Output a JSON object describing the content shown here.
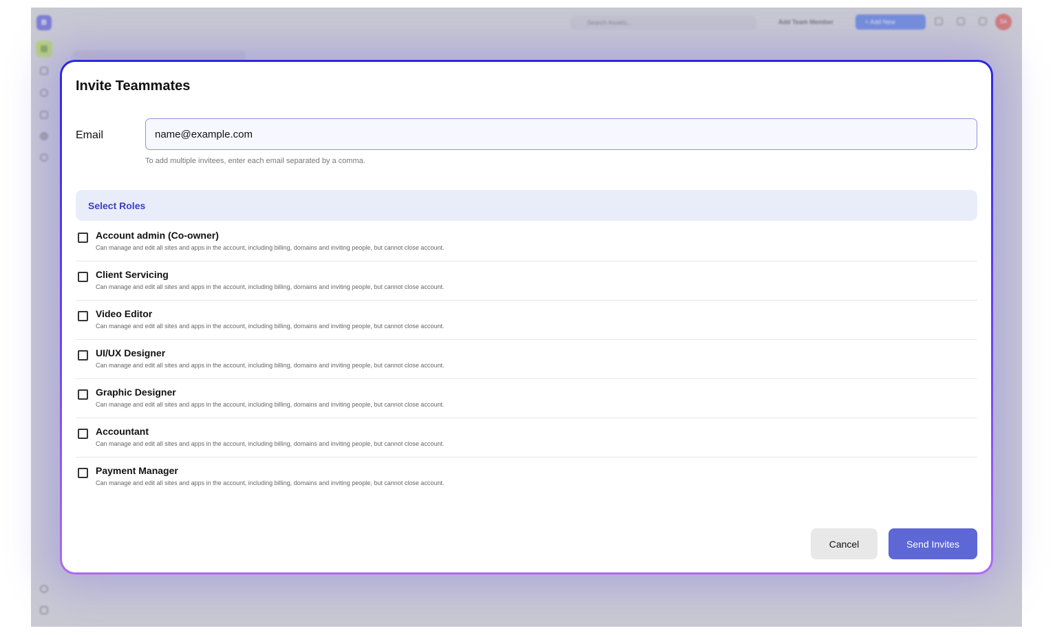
{
  "background": {
    "logo_letter": "B",
    "search_placeholder": "Search Assets...",
    "add_team_member_label": "Add Team Member",
    "add_new_label": "+ Add New",
    "avatar_initials": "SA"
  },
  "modal": {
    "title": "Invite Teammates",
    "email_label": "Email",
    "email_value": "name@example.com",
    "email_hint": "To add multiple invitees, enter each email separated by a comma.",
    "roles_header": "Select Roles",
    "roles": [
      {
        "title": "Account admin (Co-owner)",
        "description": "Can manage and edit all sites and apps in the account, including billing, domains and inviting people, but cannot close account.",
        "checked": false
      },
      {
        "title": "Client Servicing",
        "description": "Can manage and edit all sites and apps in the account, including billing, domains and inviting people, but cannot close account.",
        "checked": false
      },
      {
        "title": "Video Editor",
        "description": "Can manage and edit all sites and apps in the account, including billing, domains and inviting people, but cannot close account.",
        "checked": false
      },
      {
        "title": "UI/UX Designer",
        "description": "Can manage and edit all sites and apps in the account, including billing, domains and inviting people, but cannot close account.",
        "checked": false
      },
      {
        "title": "Graphic Designer",
        "description": "Can manage and edit all sites and apps in the account, including billing, domains and inviting people, but cannot close account.",
        "checked": false
      },
      {
        "title": "Accountant",
        "description": "Can manage and edit all sites and apps in the account, including billing, domains and inviting people, but cannot close account.",
        "checked": false
      },
      {
        "title": "Payment Manager",
        "description": "Can manage and edit all sites and apps in the account, including billing, domains and inviting people, but cannot close account.",
        "checked": false
      }
    ],
    "cancel_label": "Cancel",
    "send_label": "Send Invites"
  },
  "colors": {
    "accent": "#5d67d6",
    "roles_header_bg": "#e9edfa",
    "modal_border_top": "#2d27e0",
    "modal_border_bottom": "#b069f2"
  }
}
